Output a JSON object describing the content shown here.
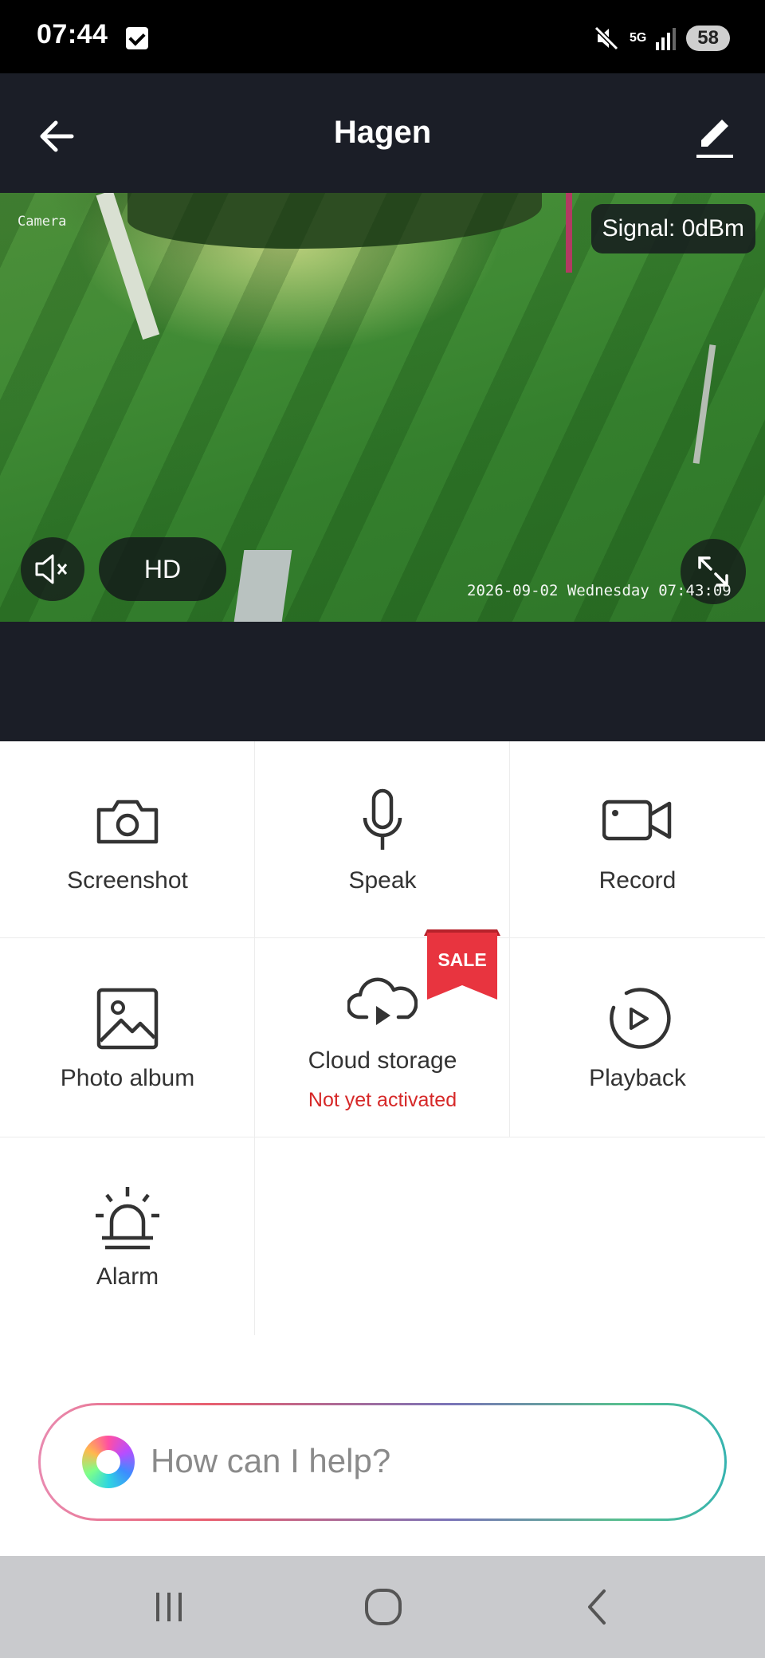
{
  "status_bar": {
    "time": "07:44",
    "network": "5G",
    "battery": "58"
  },
  "header": {
    "title": "Hagen"
  },
  "feed": {
    "camera_label": "Camera",
    "signal": "Signal: 0dBm",
    "quality": "HD",
    "timestamp": "2026-09-02 Wednesday 07:43:09"
  },
  "actions": [
    {
      "label": "Screenshot",
      "icon": "camera-icon"
    },
    {
      "label": "Speak",
      "icon": "microphone-icon"
    },
    {
      "label": "Record",
      "icon": "video-camera-icon"
    },
    {
      "label": "Photo album",
      "icon": "image-icon"
    },
    {
      "label": "Cloud storage",
      "sublabel": "Not yet activated",
      "badge": "SALE",
      "icon": "cloud-play-icon"
    },
    {
      "label": "Playback",
      "icon": "playback-icon"
    },
    {
      "label": "Alarm",
      "icon": "alarm-siren-icon"
    }
  ],
  "assistant": {
    "placeholder": "How can I help?"
  },
  "colors": {
    "header_bg": "#1b1e27",
    "sale_red": "#e8343f",
    "sublabel_red": "#d62828",
    "nav_bg": "#c9cacd"
  }
}
